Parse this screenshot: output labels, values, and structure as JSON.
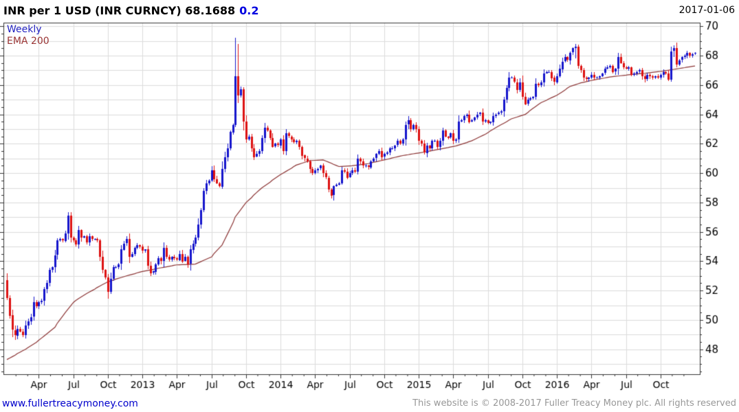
{
  "header": {
    "title": "INR per 1 USD (INR CURNCY) 68.1688",
    "change": "0.2",
    "date": "2017-01-06"
  },
  "legend": {
    "timeframe": "Weekly",
    "overlay": "EMA 200"
  },
  "footer": {
    "site_link": "www.fullertreacymoney.com",
    "copyright": "This website is © 2008-2017 Fuller Treacy Money plc. All rights reserved"
  },
  "chart_data": {
    "type": "candlestick",
    "instrument": "INR per 1 USD (INR CURNCY)",
    "frequency": "weekly",
    "last_price": 68.1688,
    "change_pct": 0.2,
    "as_of": "2017-01-06",
    "ylim": [
      46.3,
      70.25
    ],
    "y_major_ticks": [
      48,
      50,
      52,
      54,
      56,
      58,
      60,
      62,
      64,
      66,
      68,
      70
    ],
    "y_minor_step": 0.5,
    "grid_h_step": 1,
    "y_axis_side": "right",
    "legend_position": "top-left",
    "x_labels": [
      [
        12,
        "Apr"
      ],
      [
        25,
        "Jul"
      ],
      [
        38,
        "Oct"
      ],
      [
        51,
        "2013"
      ],
      [
        64,
        "Apr"
      ],
      [
        77,
        "Jul"
      ],
      [
        90,
        "Oct"
      ],
      [
        103,
        "2014"
      ],
      [
        116,
        "Apr"
      ],
      [
        129,
        "Jul"
      ],
      [
        142,
        "Oct"
      ],
      [
        155,
        "2015"
      ],
      [
        168,
        "Apr"
      ],
      [
        181,
        "Jul"
      ],
      [
        194,
        "Oct"
      ],
      [
        207,
        "2016"
      ],
      [
        220,
        "Apr"
      ],
      [
        233,
        "Jul"
      ],
      [
        246,
        "Oct"
      ]
    ],
    "initial_open": 52.7,
    "weekly_closes": [
      51.5,
      50.3,
      49.3,
      48.95,
      49.4,
      49.2,
      48.95,
      49.6,
      49.9,
      50.2,
      51.2,
      50.9,
      51.2,
      51.3,
      52.1,
      52.5,
      53.4,
      53.6,
      54.4,
      55.4,
      55.5,
      55.4,
      55.9,
      57.1,
      55.6,
      55.4,
      55.1,
      56.1,
      55.6,
      55.7,
      55.3,
      55.7,
      55.5,
      55.5,
      55.4,
      54.3,
      53.4,
      52.9,
      51.9,
      52.8,
      53.6,
      53.6,
      53.8,
      54.8,
      55.2,
      55.5,
      54.3,
      54.5,
      54.9,
      55.1,
      55.0,
      54.7,
      54.8,
      53.7,
      53.2,
      53.3,
      53.8,
      54.2,
      54.0,
      54.9,
      54.3,
      54.1,
      54.3,
      54.2,
      54.1,
      54.5,
      54.0,
      54.3,
      53.8,
      54.8,
      55.2,
      55.6,
      56.5,
      57.5,
      58.8,
      59.3,
      59.5,
      60.2,
      59.6,
      59.3,
      59.1,
      60.3,
      61.1,
      61.7,
      62.8,
      63.3,
      66.6,
      65.3,
      65.7,
      63.5,
      62.3,
      62.5,
      61.7,
      61.1,
      61.3,
      61.5,
      62.4,
      63.1,
      62.9,
      62.4,
      61.8,
      62.0,
      61.9,
      62.3,
      61.5,
      62.7,
      62.5,
      62.3,
      62.1,
      62.2,
      61.8,
      61.2,
      61.0,
      60.8,
      60.3,
      60.0,
      60.2,
      60.3,
      60.5,
      60.0,
      59.7,
      58.9,
      58.5,
      59.1,
      59.2,
      59.3,
      60.2,
      60.1,
      59.7,
      60.0,
      60.2,
      60.1,
      61.0,
      60.8,
      60.5,
      60.5,
      60.4,
      60.8,
      61.0,
      61.3,
      61.5,
      61.1,
      61.3,
      61.4,
      61.7,
      61.7,
      61.9,
      62.2,
      62.0,
      62.3,
      63.3,
      63.6,
      63.0,
      63.3,
      63.0,
      62.2,
      62.0,
      61.4,
      61.9,
      61.7,
      62.2,
      62.2,
      61.8,
      62.2,
      62.9,
      62.5,
      62.4,
      62.7,
      62.2,
      62.3,
      63.5,
      63.6,
      63.9,
      64.0,
      63.5,
      63.6,
      63.8,
      64.0,
      64.1,
      63.5,
      63.6,
      63.4,
      63.5,
      63.9,
      64.0,
      64.1,
      64.2,
      65.0,
      65.8,
      66.5,
      66.5,
      66.2,
      65.7,
      66.2,
      65.2,
      64.7,
      65.0,
      65.1,
      65.2,
      66.1,
      66.0,
      66.2,
      66.8,
      66.9,
      66.9,
      66.5,
      66.2,
      66.6,
      67.1,
      67.6,
      67.9,
      67.7,
      68.2,
      68.5,
      68.6,
      67.3,
      67.0,
      66.5,
      66.4,
      66.5,
      66.7,
      66.5,
      66.5,
      66.6,
      66.8,
      67.1,
      67.2,
      67.3,
      66.9,
      67.1,
      67.9,
      67.5,
      67.2,
      67.1,
      67.2,
      66.7,
      66.8,
      66.9,
      67.0,
      66.6,
      66.4,
      66.7,
      66.6,
      66.5,
      66.6,
      66.5,
      66.7,
      66.9,
      66.8,
      66.4,
      68.3,
      68.5,
      67.4,
      67.7,
      67.9,
      68.0,
      68.2,
      68.0,
      68.1,
      68.17
    ],
    "wick_overrides": [
      [
        3,
        49.6,
        48.6
      ],
      [
        23,
        57.35,
        55.5
      ],
      [
        86,
        69.2,
        63.1
      ],
      [
        87,
        68.8,
        64.8
      ],
      [
        122,
        59.0,
        58.3
      ],
      [
        151,
        63.9,
        63.0
      ],
      [
        189,
        66.9,
        65.6
      ],
      [
        214,
        68.8,
        67.8
      ],
      [
        230,
        68.2,
        66.7
      ],
      [
        250,
        68.6,
        66.2
      ],
      [
        251,
        68.7,
        67.9
      ],
      [
        252,
        68.9,
        67.2
      ]
    ],
    "overlay": {
      "name": "EMA 200",
      "anchors": [
        [
          0,
          47.3
        ],
        [
          7,
          48.0
        ],
        [
          12,
          48.6
        ],
        [
          18,
          49.5
        ],
        [
          22,
          50.5
        ],
        [
          25,
          51.2
        ],
        [
          30,
          51.8
        ],
        [
          35,
          52.3
        ],
        [
          38,
          52.6
        ],
        [
          45,
          53.0
        ],
        [
          51,
          53.3
        ],
        [
          58,
          53.55
        ],
        [
          64,
          53.75
        ],
        [
          71,
          53.8
        ],
        [
          77,
          54.3
        ],
        [
          81,
          55.1
        ],
        [
          86,
          57.0
        ],
        [
          90,
          58.0
        ],
        [
          96,
          59.0
        ],
        [
          103,
          59.9
        ],
        [
          109,
          60.55
        ],
        [
          114,
          60.85
        ],
        [
          119,
          60.9
        ],
        [
          125,
          60.45
        ],
        [
          130,
          60.5
        ],
        [
          136,
          60.65
        ],
        [
          142,
          60.9
        ],
        [
          149,
          61.2
        ],
        [
          156,
          61.4
        ],
        [
          162,
          61.6
        ],
        [
          169,
          61.85
        ],
        [
          175,
          62.2
        ],
        [
          180,
          62.65
        ],
        [
          185,
          63.2
        ],
        [
          190,
          63.7
        ],
        [
          195,
          64.0
        ],
        [
          201,
          64.8
        ],
        [
          207,
          65.3
        ],
        [
          212,
          65.9
        ],
        [
          216,
          66.15
        ],
        [
          221,
          66.35
        ],
        [
          227,
          66.55
        ],
        [
          234,
          66.7
        ],
        [
          240,
          66.8
        ],
        [
          247,
          66.95
        ],
        [
          252,
          67.1
        ],
        [
          259,
          67.3
        ]
      ]
    },
    "colors": {
      "up": "#1414CC",
      "down": "#DD1111",
      "ema": "#8B3333",
      "grid": "#DCDCDC",
      "axis": "#333333",
      "text": "#000000"
    }
  }
}
